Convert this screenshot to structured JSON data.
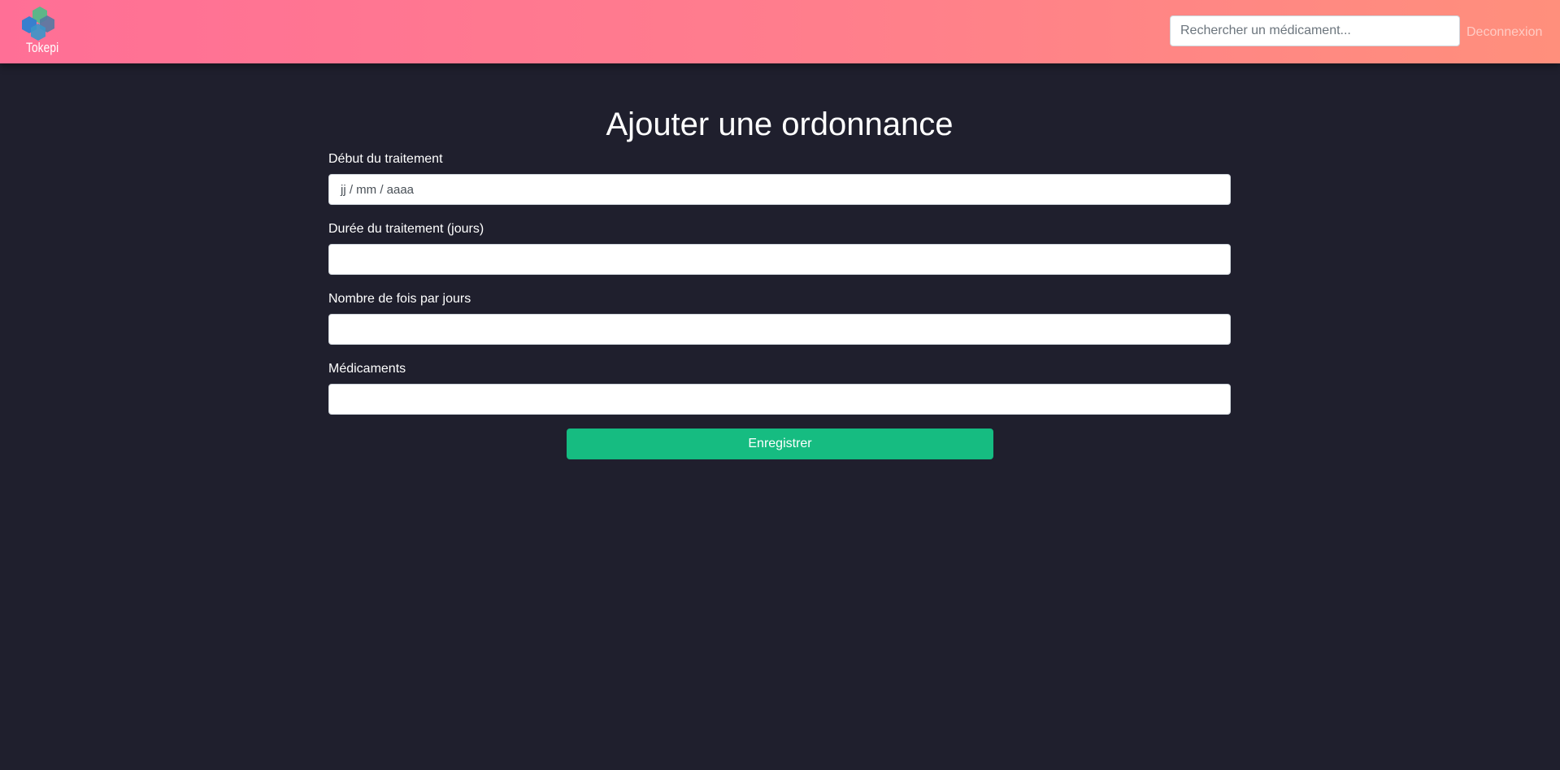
{
  "navbar": {
    "brand_name": "Tokepi",
    "search_placeholder": "Rechercher un médicament...",
    "logout_label": "Deconnexion"
  },
  "page": {
    "title": "Ajouter une ordonnance"
  },
  "form": {
    "start_date": {
      "label": "Début du traitement",
      "placeholder": "jj / mm / aaaa"
    },
    "duration": {
      "label": "Durée du traitement (jours)",
      "value": ""
    },
    "times_per_day": {
      "label": "Nombre de fois par jours",
      "value": ""
    },
    "medications": {
      "label": "Médicaments",
      "value": ""
    },
    "submit_label": "Enregistrer"
  },
  "colors": {
    "navbar_gradient_start": "#ff6f96",
    "navbar_gradient_end": "#ff8f7c",
    "page_background": "#1f1f2d",
    "primary_button": "#16bc81",
    "text_primary": "#ffffff",
    "input_background": "#ffffff",
    "input_border": "#ced4da"
  },
  "icons": {
    "brand_logo": "tokepi-hexagon-logo"
  }
}
